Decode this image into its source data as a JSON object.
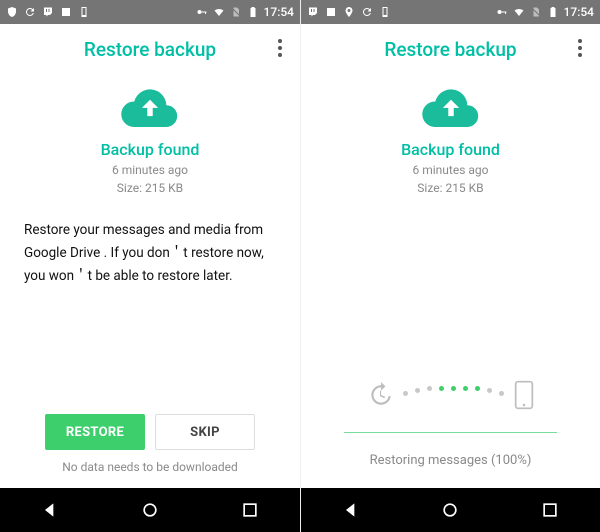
{
  "status": {
    "time": "17:54"
  },
  "appbar": {
    "title": "Restore backup"
  },
  "backup": {
    "heading": "Backup found",
    "age": "6 minutes ago",
    "size": "Size: 215 KB"
  },
  "left": {
    "description": "Restore your messages and media from Google Drive . If you don＇t restore now, you won＇t be able to restore later.",
    "restore_label": "RESTORE",
    "skip_label": "SKIP",
    "footnote": "No data needs to be downloaded"
  },
  "right": {
    "progress_text": "Restoring messages (100%)"
  },
  "colors": {
    "accent": "#00bfa5",
    "action": "#3ecf6d"
  }
}
